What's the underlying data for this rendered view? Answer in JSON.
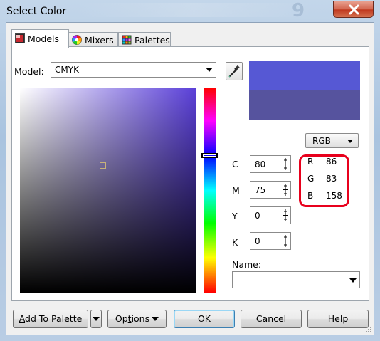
{
  "window": {
    "title": "Select Color"
  },
  "tabs": [
    {
      "label": "Models",
      "icon": "models-icon",
      "active": true
    },
    {
      "label": "Mixers",
      "icon": "mixers-icon",
      "active": false
    },
    {
      "label": "Palettes",
      "icon": "palettes-icon",
      "active": false
    }
  ],
  "model": {
    "label": "Model:",
    "value": "CMYK"
  },
  "color_space_button": {
    "label": "RGB"
  },
  "cmyk": [
    {
      "key": "C",
      "value": "80"
    },
    {
      "key": "M",
      "value": "75"
    },
    {
      "key": "Y",
      "value": "0"
    },
    {
      "key": "K",
      "value": "0"
    }
  ],
  "rgb": [
    {
      "key": "R",
      "value": "86"
    },
    {
      "key": "G",
      "value": "83"
    },
    {
      "key": "B",
      "value": "158"
    }
  ],
  "name": {
    "label": "Name:",
    "value": ""
  },
  "colors": {
    "new_swatch": "#5658d4",
    "old_swatch": "#56539e",
    "highlight": "#e8001c"
  },
  "buttons": {
    "add_to_palette_pre": "",
    "add_to_palette_ul": "A",
    "add_to_palette_post": "dd To Palette",
    "options_pre": "Op",
    "options_ul": "t",
    "options_post": "ions",
    "ok": "OK",
    "cancel": "Cancel",
    "help": "Help"
  }
}
